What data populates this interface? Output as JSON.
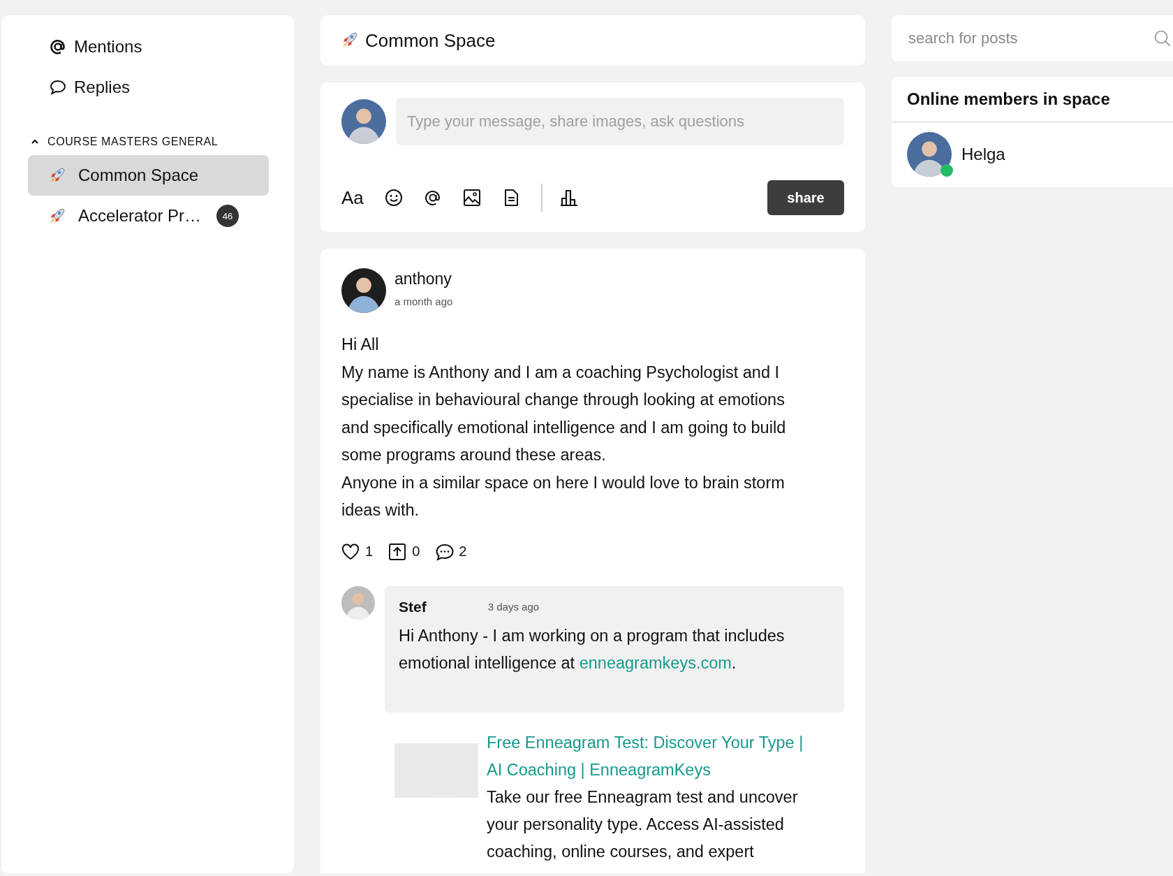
{
  "sidebar": {
    "items": [
      {
        "kind": "mention",
        "label": "Mentions"
      },
      {
        "kind": "reply",
        "label": "Replies"
      }
    ],
    "section": {
      "title": "COURSE MASTERS GENERAL",
      "expanded": true,
      "spaces": [
        {
          "label": "Common Space",
          "selected": true
        },
        {
          "label": "Accelerator Pr…",
          "selected": false,
          "badge": "46"
        }
      ]
    }
  },
  "header": {
    "title": "Common Space"
  },
  "composer": {
    "placeholder": "Type your message, share images, ask questions",
    "tools": [
      {
        "kind": "text",
        "label": "Aa"
      },
      {
        "kind": "emoji"
      },
      {
        "kind": "mention"
      },
      {
        "kind": "image"
      },
      {
        "kind": "file"
      },
      {
        "kind": "divider"
      },
      {
        "kind": "poll"
      }
    ],
    "share": "share"
  },
  "post": {
    "author": "anthony",
    "time": "a month ago",
    "paragraphs": [
      "Hi All",
      "My name is Anthony and I am a coaching Psychologist and I specialise in behavioural change through looking at emotions and specifically emotional intelligence and I am going to build some programs around these areas.",
      "Anyone in a similar space on here I would love to brain storm ideas with."
    ],
    "reactions": [
      {
        "kind": "like",
        "count": "1"
      },
      {
        "kind": "upvote",
        "count": "0"
      },
      {
        "kind": "comment",
        "count": "2"
      }
    ],
    "comment": {
      "author": "Stef",
      "time": "3 days ago",
      "text": "Hi Anthony - I am working on a program that includes emotional intelligence at ",
      "link": "enneagramkeys.com",
      "after": ".",
      "preview": {
        "title": "Free Enneagram Test: Discover Your Type | AI Coaching | EnneagramKeys",
        "description": "Take our free Enneagram test and uncover your personality type. Access AI-assisted coaching, online courses, and expert"
      }
    }
  },
  "search": {
    "placeholder": "search for posts"
  },
  "online": {
    "title": "Online members in space",
    "members": [
      {
        "name": "Helga",
        "online": true
      }
    ]
  }
}
